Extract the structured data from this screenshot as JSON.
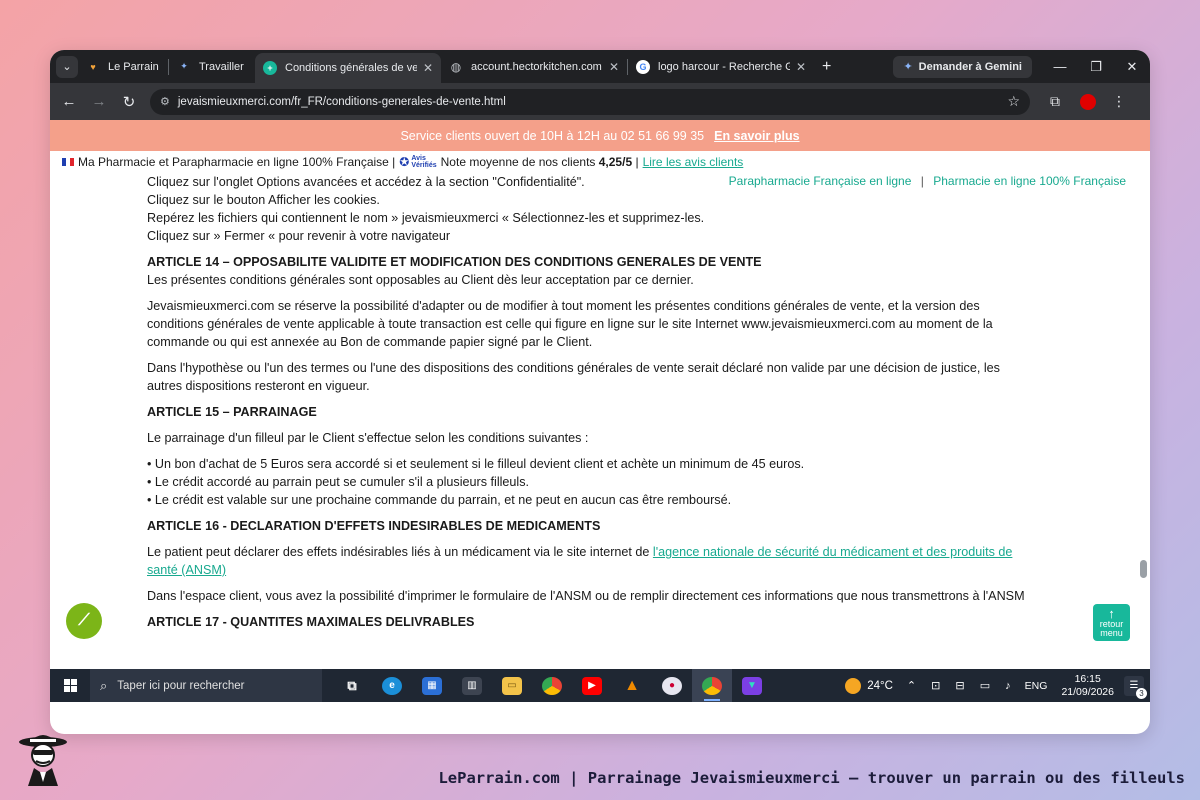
{
  "browser": {
    "tabs": [
      {
        "label": "Le Parrain - L",
        "favicon": "leparrain-icon",
        "active": false
      },
      {
        "label": "Travailler sur",
        "favicon": "gemini-star-icon",
        "active": false
      },
      {
        "label": "Conditions générales de vente",
        "favicon": "pharmacy-cross-icon",
        "active": true
      },
      {
        "label": "account.hectorkitchen.com",
        "favicon": "globe-icon",
        "active": false
      },
      {
        "label": "logo harcour - Recherche Goo",
        "favicon": "google-icon",
        "active": false
      }
    ],
    "gemini_label": "Demander à Gemini",
    "url": "jevaismieuxmerci.com/fr_FR/conditions-generales-de-vente.html"
  },
  "page": {
    "promo_text": "Service clients ouvert de 10H à 12H au 02 51 66 99 35",
    "promo_link": "En savoir plus",
    "trust_text": "Ma Pharmacie et Parapharmacie en ligne 100% Française |",
    "avis_line1": "Avis",
    "avis_line2": "Vérifiés",
    "rating_text": "Note moyenne de nos clients",
    "rating_value": "4,25/5",
    "rating_sep": "|",
    "reviews_link": "Lire les avis clients",
    "sublink_1": "Parapharmacie Française en ligne",
    "sublink_sep": "|",
    "sublink_2": "Pharmacie en ligne 100% Française",
    "lines_top": [
      "Cliquez sur l'onglet Options avancées et accédez à la section \"Confidentialité\".",
      "Cliquez sur le bouton Afficher les cookies.",
      "Repérez les fichiers qui contiennent le nom » jevaismieuxmerci « Sélectionnez-les et supprimez-les.",
      "Cliquez sur » Fermer « pour revenir à votre navigateur"
    ],
    "article14": {
      "title": "ARTICLE 14 – OPPOSABILITE VALIDITE ET MODIFICATION DES CONDITIONS GENERALES DE VENTE",
      "p1": "Les présentes conditions générales sont opposables au Client dès leur acceptation par ce dernier.",
      "p2": "Jevaismieuxmerci.com se réserve la possibilité d'adapter ou de modifier à tout moment les présentes conditions générales de vente, et la version des conditions générales de vente applicable à toute transaction est celle qui figure en ligne sur le site Internet www.jevaismieuxmerci.com au moment de la commande ou qui est annexée au Bon de commande papier signé par le Client.",
      "p3": "Dans l'hypothèse ou l'un des termes ou l'une des dispositions des conditions générales de vente serait déclaré non valide par une décision de justice, les autres dispositions resteront en vigueur."
    },
    "article15": {
      "title": "ARTICLE 15 – PARRAINAGE",
      "intro": "Le parrainage d'un filleul par le Client s'effectue selon les conditions suivantes :",
      "bullets": [
        "• Un bon d'achat de 5 Euros sera accordé si et seulement si le filleul devient client et achète un minimum de 45 euros.",
        "• Le crédit accordé au parrain peut se cumuler s'il a plusieurs filleuls.",
        "• Le crédit est valable sur une prochaine commande du parrain, et ne peut en aucun cas être remboursé."
      ]
    },
    "article16": {
      "title": "ARTICLE 16 - DECLARATION D'EFFETS INDESIRABLES DE MEDICAMENTS",
      "p1_text": "Le patient peut déclarer des effets indésirables liés à un médicament via le site internet de",
      "p1_link": "l'agence nationale de sécurité du médicament et des produits de santé (ANSM)",
      "p2": "Dans l'espace client, vous avez la possibilité d'imprimer le formulaire de l'ANSM ou de remplir directement ces informations que nous transmettrons à l'ANSM"
    },
    "article17_partial": "ARTICLE 17 - QUANTITES MAXIMALES DELIVRABLES",
    "back_to_menu_line1": "retour",
    "back_to_menu_line2": "menu"
  },
  "taskbar": {
    "search_placeholder": "Taper ici pour rechercher",
    "weather": "24°C",
    "lang": "ENG",
    "time": "16:15",
    "date": "21/09/2026",
    "notifications": "3"
  },
  "footer": {
    "caption": "LeParrain.com | Parrainage Jevaismieuxmerci — trouver un parrain ou des filleuls"
  },
  "colors": {
    "promo_bg": "#f4a08a",
    "link_green": "#18a98f",
    "taskbar_bg": "#1f2733",
    "chrome_dark": "#202124"
  }
}
